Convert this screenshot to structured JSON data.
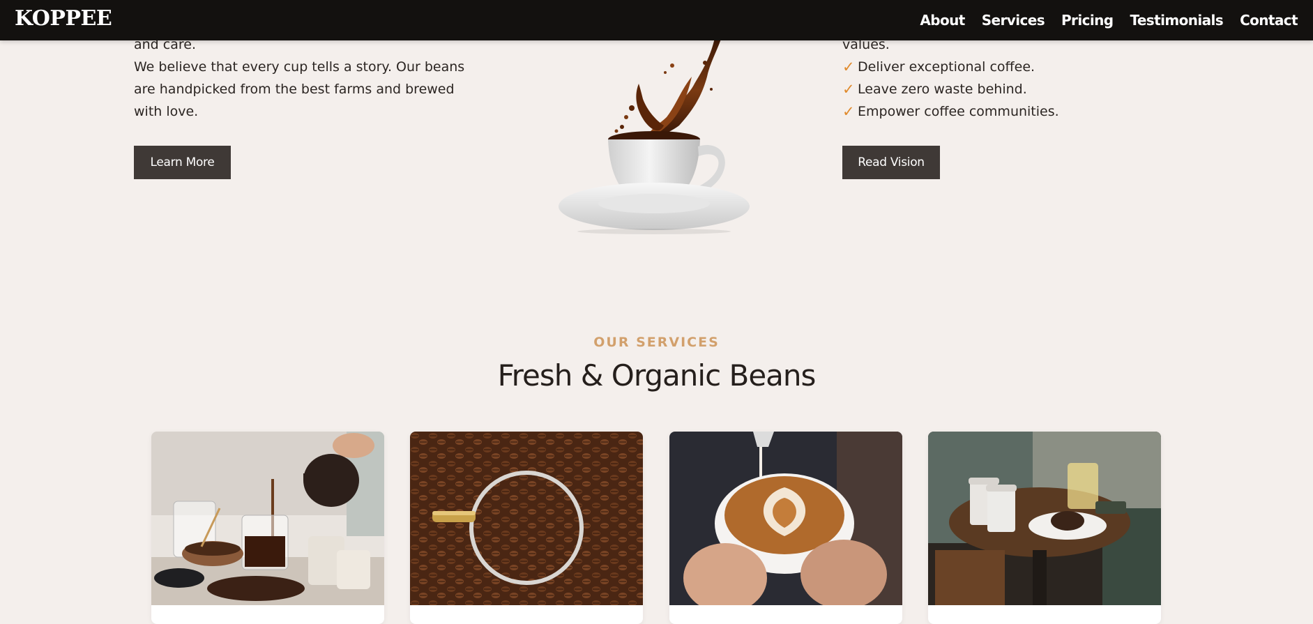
{
  "brand": {
    "logo": "KOPPEE"
  },
  "nav": {
    "items": [
      {
        "label": "About"
      },
      {
        "label": "Services"
      },
      {
        "label": "Pricing"
      },
      {
        "label": "Testimonials"
      },
      {
        "label": "Contact"
      }
    ]
  },
  "about": {
    "line_top": "and care.",
    "paragraph": "We believe that every cup tells a story. Our beans are handpicked from the best farms and brewed with love.",
    "button_label": "Learn More"
  },
  "vision": {
    "line_top": "values.",
    "items": [
      {
        "text": "Deliver exceptional coffee."
      },
      {
        "text": "Leave zero waste behind."
      },
      {
        "text": "Empower coffee communities."
      }
    ],
    "check_icon": "✓",
    "button_label": "Read Vision"
  },
  "services": {
    "eyebrow": "OUR SERVICES",
    "title": "Fresh & Organic Beans",
    "cards": [
      {
        "image": "coffee-pour-over-photo"
      },
      {
        "image": "coffee-beans-cup-photo"
      },
      {
        "image": "latte-art-photo"
      },
      {
        "image": "cafe-table-photo"
      }
    ]
  },
  "colors": {
    "navbar_bg": "#13110f",
    "page_bg": "#f4efec",
    "accent": "#d2a06c",
    "check": "#e08a2c",
    "button_bg": "#3f3936"
  }
}
